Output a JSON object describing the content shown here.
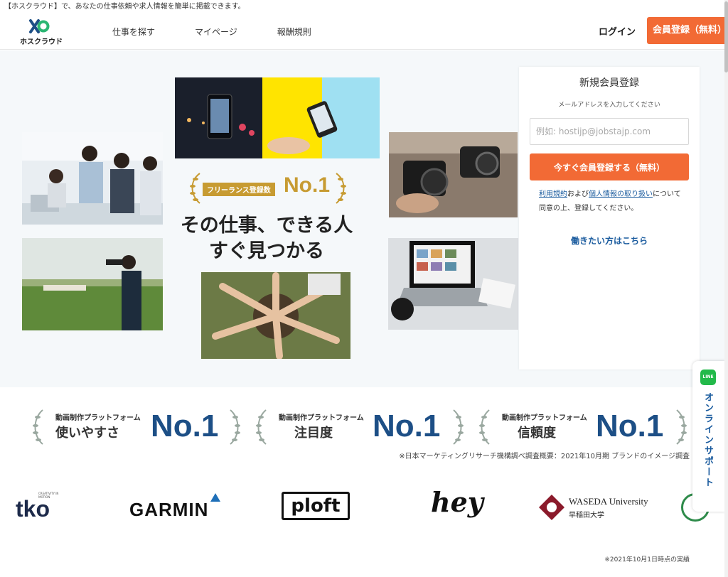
{
  "topline": "【ホスクラウド】で、あなたの仕事依頼や求人情報を簡単に掲載できます。",
  "header": {
    "logo_text": "ホスクラウド",
    "nav": [
      "仕事を探す",
      "マイページ",
      "報酬規則"
    ],
    "login": "ログイン",
    "register": "会員登録（無料）"
  },
  "hero": {
    "badge_label": "フリーランス登録数",
    "badge_no1": "No.1",
    "headline_line1": "その仕事、できる人",
    "headline_line2": "すぐ見つかる"
  },
  "signup": {
    "title": "新規会員登録",
    "subtitle": "メールアドレスを入力してください",
    "email_placeholder": "例如: hostijp@jobstajp.com",
    "submit": "今すぐ会員登録する（無料）",
    "terms_link1": "利用規約",
    "terms_and": "および",
    "terms_link2": "個人情報の取り扱い",
    "terms_rest": "について同意の上、登録してください。",
    "worker_link": "働きたい方はこちら"
  },
  "awards": {
    "items": [
      {
        "small": "動画制作プラットフォーム",
        "big": "使いやすさ",
        "no1": "No.1"
      },
      {
        "small": "動画制作プラットフォーム",
        "big": "注目度",
        "no1": "No.1"
      },
      {
        "small": "動画制作プラットフォーム",
        "big": "信頼度",
        "no1": "No.1"
      }
    ],
    "note": "※日本マーケティングリサーチ機構調べ調査概要：2021年10月期 ブランドのイメージ調査"
  },
  "logos": {
    "tko": "tko",
    "tko_tag": "CREATIVITY IN MOTION",
    "garmin": "GARMIN",
    "ploft": "ploft",
    "hey": "hey",
    "waseda_en": "WASEDA University",
    "waseda_jp": "早稲田大学"
  },
  "footnote": "※2021年10月1日時点の実績",
  "support": {
    "icon_text": "LINE",
    "label": "オンラインサポート"
  },
  "colors": {
    "accent": "#f26a35",
    "link": "#1a5b9e",
    "navy": "#1d4f86",
    "gold": "#c79b32"
  }
}
